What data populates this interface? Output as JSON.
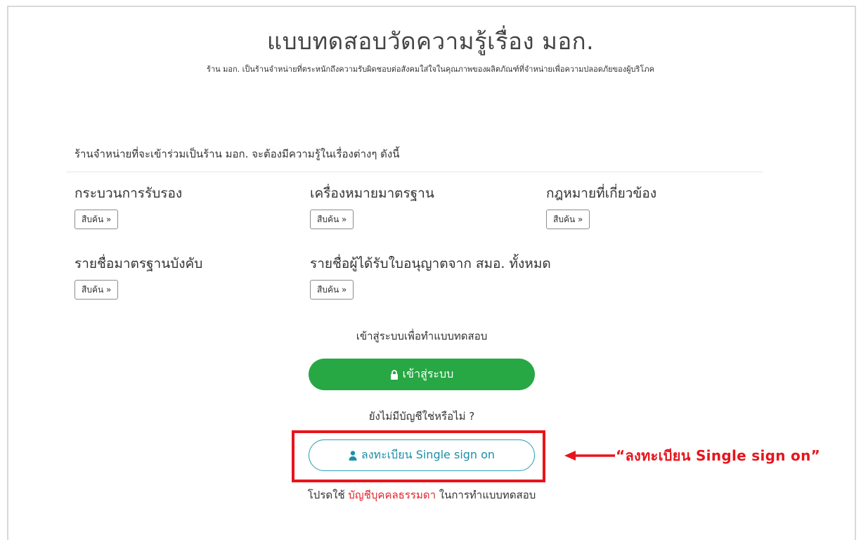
{
  "header": {
    "title": "แบบทดสอบวัดความรู้เรื่อง มอก.",
    "subtitle": "ร้าน มอก. เป็นร้านจำหน่ายที่ตระหนักถึงความรับผิดชอบต่อสังคมใส่ใจในคุณภาพของผลิตภัณฑ์ที่จำหน่ายเพื่อความปลอดภัยของผู้บริโภค"
  },
  "intro": "ร้านจำหน่ายที่จะเข้าร่วมเป็นร้าน มอก. จะต้องมีความรู้ในเรื่องต่างๆ ดังนี้",
  "categories": [
    {
      "title": "กระบวนการรับรอง",
      "button": "สืบค้น »"
    },
    {
      "title": "เครื่องหมายมาตรฐาน",
      "button": "สืบค้น »"
    },
    {
      "title": "กฎหมายที่เกี่ยวข้อง",
      "button": "สืบค้น »"
    },
    {
      "title": "รายชื่อมาตรฐานบังคับ",
      "button": "สืบค้น »"
    },
    {
      "title": "รายชื่อผู้ได้รับใบอนุญาตจาก สมอ. ทั้งหมด",
      "button": "สืบค้น »"
    }
  ],
  "login": {
    "caption": "เข้าสู่ระบบเพื่อทำแบบทดสอบ",
    "button": "เข้าสู่ระบบ",
    "icon": "lock-icon"
  },
  "register": {
    "question": "ยังไม่มีบัญชีใช่หรือไม่ ?",
    "button": "ลงทะเบียน Single sign on",
    "icon": "user-icon",
    "note_prefix": "โปรดใช้ ",
    "note_highlight": "บัญชีบุคคลธรรมดา",
    "note_suffix": " ในการทำแบบทดสอบ"
  },
  "annotation": {
    "text": "“ลงทะเบียน Single sign on”",
    "color": "#e8141c"
  },
  "colors": {
    "login_button": "#28a745",
    "register_border": "#2aa0b8",
    "highlight": "#e8141c"
  }
}
